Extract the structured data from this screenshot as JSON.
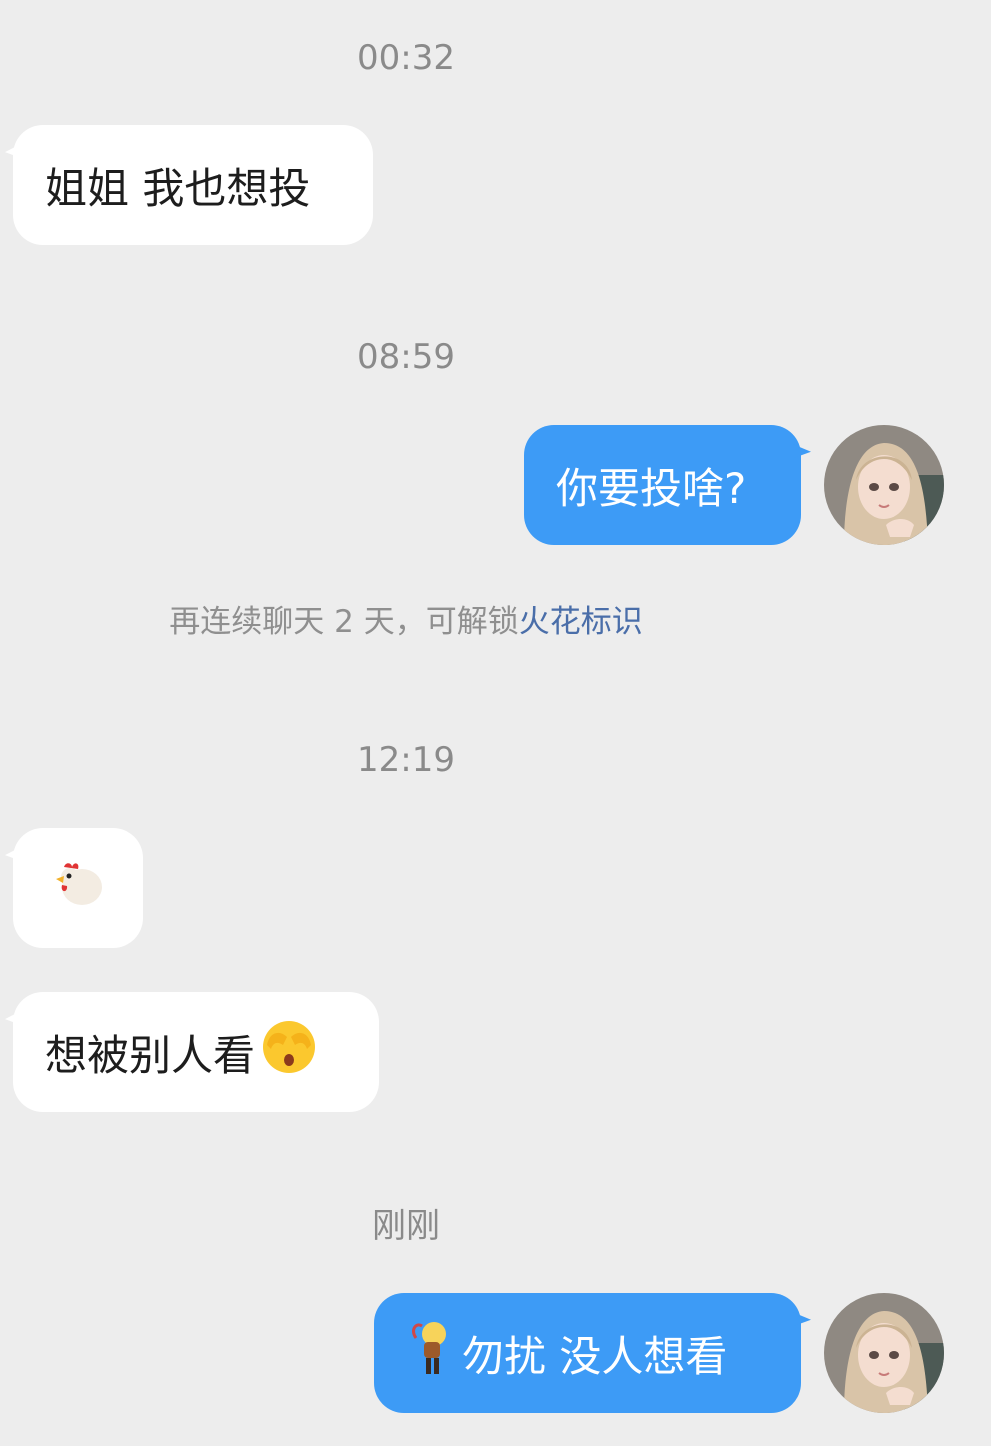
{
  "messages": {
    "ts1": "00:32",
    "m1": "姐姐 我也想投",
    "ts2": "08:59",
    "m2": "你要投啥?",
    "notice_prefix": "再连续聊天 2 天，可解锁",
    "notice_link": "火花标识",
    "ts3": "12:19",
    "m3_emoji": "chicken-emoji",
    "m4": "想被别人看",
    "m4_emoji": "face-covering-eyes-emoji",
    "ts4": "刚刚",
    "m5_emoji": "bulb-head-figure-emoji",
    "m5": "勿扰 没人想看"
  },
  "colors": {
    "background": "#ededed",
    "incoming_bubble": "#ffffff",
    "outgoing_bubble": "#3d9bf6",
    "link": "#4a6ea9"
  }
}
